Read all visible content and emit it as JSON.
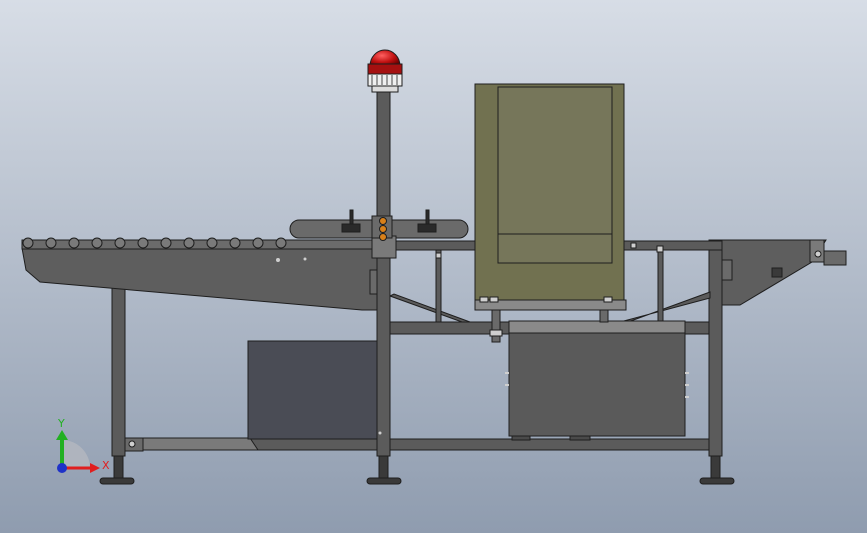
{
  "triad": {
    "x_label": "X",
    "y_label": "Y",
    "z_label": "",
    "x_color": "#e01e1e",
    "y_color": "#22b022",
    "z_color": "#1e32c8"
  },
  "colors": {
    "bg_top": "#d7dde6",
    "bg_bottom": "#8f9caf",
    "frame": "#5b5b5b",
    "frame_dark": "#2a2a2a",
    "cabinet": "#717150",
    "cabinet_inner": "#76765a",
    "box_dark": "#4a4c55",
    "tank": "#5a5a5a",
    "beacon_red": "#c01010",
    "orange_knob": "#d8801a"
  },
  "components": [
    "infeed-conveyor",
    "outfeed-conveyor",
    "inspection-cabinet",
    "signal-beacon",
    "support-frame",
    "control-box",
    "reject-tank",
    "leveling-feet"
  ]
}
